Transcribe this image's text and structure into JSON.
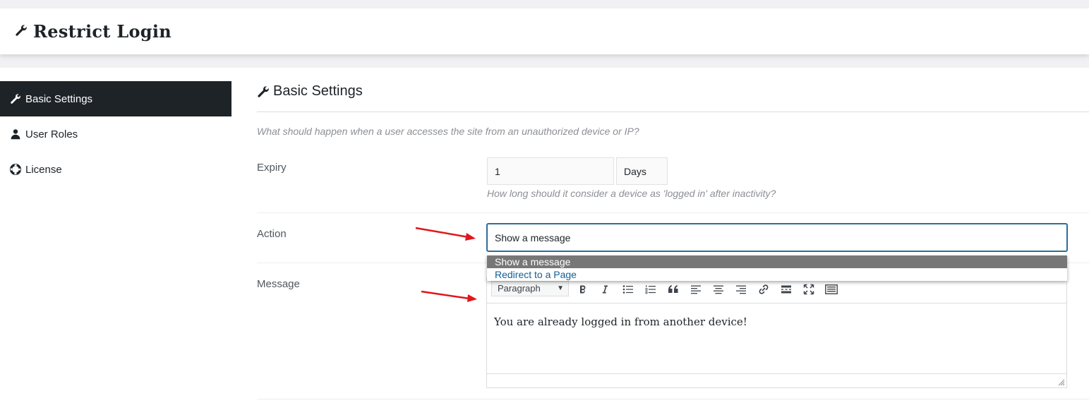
{
  "header": {
    "title": "Restrict Login",
    "logo_icon": "wrench-icon"
  },
  "sidebar": {
    "items": [
      {
        "label": "Basic Settings",
        "icon": "wrench-icon",
        "active": true
      },
      {
        "label": "User Roles",
        "icon": "user-icon",
        "active": false
      },
      {
        "label": "License",
        "icon": "lifebuoy-icon",
        "active": false
      }
    ]
  },
  "main": {
    "title": "Basic Settings",
    "description": "What should happen when a user accesses the site from an unauthorized device or IP?",
    "expiry": {
      "label": "Expiry",
      "value": "1",
      "unit": "Days",
      "hint": "How long should it consider a device as 'logged in' after inactivity?"
    },
    "action": {
      "label": "Action",
      "value": "Show a message",
      "options": [
        "Show a message",
        "Redirect to a Page"
      ]
    },
    "message": {
      "label": "Message",
      "format": "Paragraph",
      "content": "You are already logged in from another device!"
    }
  },
  "colors": {
    "accent": "#2c6e9b",
    "sidebar_active": "#1d2327",
    "arrow": "#e0161c"
  }
}
